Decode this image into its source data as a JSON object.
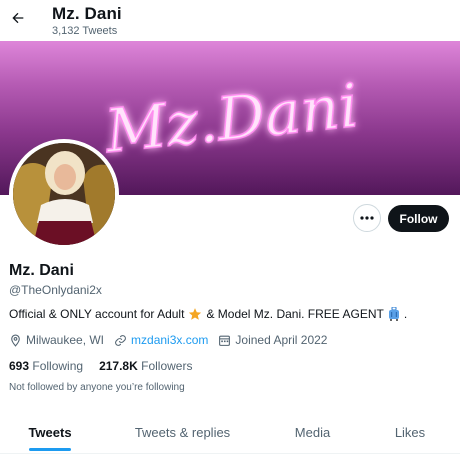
{
  "header": {
    "name": "Mz. Dani",
    "tweet_count": "3,132 Tweets",
    "back_icon": "arrow-left-icon"
  },
  "banner": {
    "text": "Mz.Dani",
    "colors": [
      "#d77bd2",
      "#8c2e8e",
      "#5e1c66"
    ]
  },
  "profile": {
    "display_name": "Mz. Dani",
    "handle": "@TheOnlydani2x",
    "bio_part1": "Official & ONLY account for Adult",
    "bio_part2": "& Model Mz. Dani. FREE AGENT",
    "bio_part3": ".",
    "bio_emojis": [
      "star-emoji",
      "luggage-emoji"
    ],
    "location": "Milwaukee, WI",
    "website": "mzdani3x.com",
    "joined": "Joined April 2022"
  },
  "stats": {
    "following_count": "693",
    "following_label": "Following",
    "followers_count": "217.8K",
    "followers_label": "Followers"
  },
  "social_context": "Not followed by anyone you’re following",
  "actions": {
    "more_icon": "more-dots-icon",
    "follow_label": "Follow"
  },
  "tabs": [
    {
      "label": "Tweets",
      "active": true
    },
    {
      "label": "Tweets & replies",
      "active": false
    },
    {
      "label": "Media",
      "active": false
    },
    {
      "label": "Likes",
      "active": false
    }
  ],
  "colors": {
    "accent": "#1d9bf0",
    "text": "#0f1419",
    "muted": "#536471"
  }
}
